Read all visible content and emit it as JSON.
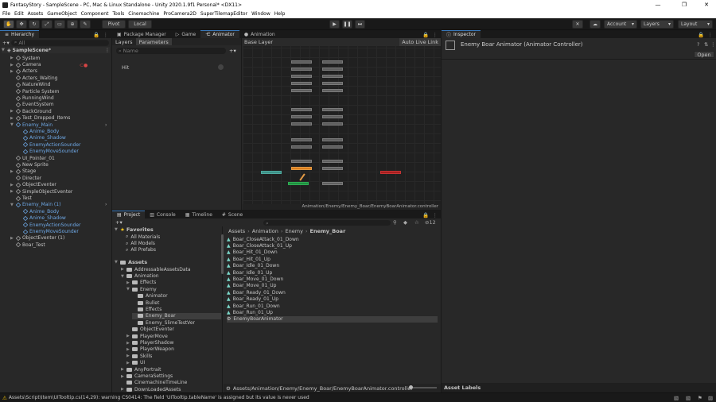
{
  "window": {
    "title": "FantasyStory - SampleScene - PC, Mac & Linux Standalone - Unity 2020.1.9f1 Personal* <DX11>",
    "minimize": "—",
    "maximize": "❐",
    "close": "✕"
  },
  "menu": [
    "File",
    "Edit",
    "Assets",
    "GameObject",
    "Component",
    "Tools",
    "Cinemachine",
    "ProCamera2D",
    "SuperTilemapEditor",
    "Window",
    "Help"
  ],
  "toolbar": {
    "pivot": "Pivot",
    "local": "Local",
    "account": "Account",
    "layers": "Layers",
    "layout": "Layout"
  },
  "hierarchy": {
    "tab": "Hierarchy",
    "search_placeholder": "All",
    "scene": "SampleScene*",
    "items": [
      {
        "label": "System",
        "indent": 1,
        "arrow": "▶",
        "blue": false
      },
      {
        "label": "Camera",
        "indent": 1,
        "arrow": "▶",
        "blue": false
      },
      {
        "label": "Acters",
        "indent": 1,
        "arrow": "▶",
        "blue": false
      },
      {
        "label": "Acters_Waiting",
        "indent": 1,
        "arrow": "",
        "blue": false
      },
      {
        "label": "NatureWind",
        "indent": 1,
        "arrow": "",
        "blue": false
      },
      {
        "label": "Particle System",
        "indent": 1,
        "arrow": "",
        "blue": false
      },
      {
        "label": "RunningWind",
        "indent": 1,
        "arrow": "",
        "blue": false
      },
      {
        "label": "EventSystem",
        "indent": 1,
        "arrow": "",
        "blue": false
      },
      {
        "label": "BackGround",
        "indent": 1,
        "arrow": "▶",
        "blue": false
      },
      {
        "label": "Test_Dropped_Items",
        "indent": 1,
        "arrow": "▶",
        "blue": false
      },
      {
        "label": "Enemy_Main",
        "indent": 1,
        "arrow": "▼",
        "blue": true
      },
      {
        "label": "Anime_Body",
        "indent": 2,
        "arrow": "",
        "blue": true
      },
      {
        "label": "Anime_Shadow",
        "indent": 2,
        "arrow": "",
        "blue": true
      },
      {
        "label": "EnemyActionSounder",
        "indent": 2,
        "arrow": "",
        "blue": true
      },
      {
        "label": "EnemyMoveSounder",
        "indent": 2,
        "arrow": "",
        "blue": true
      },
      {
        "label": "UI_Pointer_01",
        "indent": 1,
        "arrow": "",
        "blue": false
      },
      {
        "label": "New Sprite",
        "indent": 1,
        "arrow": "",
        "blue": false
      },
      {
        "label": "Stage",
        "indent": 1,
        "arrow": "▶",
        "blue": false
      },
      {
        "label": "Directer",
        "indent": 1,
        "arrow": "",
        "blue": false
      },
      {
        "label": "ObjectEventer",
        "indent": 1,
        "arrow": "▶",
        "blue": false
      },
      {
        "label": "SimpleObjectEventer",
        "indent": 1,
        "arrow": "▶",
        "blue": false
      },
      {
        "label": "Test",
        "indent": 1,
        "arrow": "",
        "blue": false
      },
      {
        "label": "Enemy_Main (1)",
        "indent": 1,
        "arrow": "▼",
        "blue": true
      },
      {
        "label": "Anime_Body",
        "indent": 2,
        "arrow": "",
        "blue": true
      },
      {
        "label": "Anime_Shadow",
        "indent": 2,
        "arrow": "",
        "blue": true
      },
      {
        "label": "EnemyActionSounder",
        "indent": 2,
        "arrow": "",
        "blue": true
      },
      {
        "label": "EnemyMoveSounder",
        "indent": 2,
        "arrow": "",
        "blue": true
      },
      {
        "label": "ObjectEventer (1)",
        "indent": 1,
        "arrow": "▶",
        "blue": false
      },
      {
        "label": "Boar_Test",
        "indent": 1,
        "arrow": "",
        "blue": false
      }
    ]
  },
  "animator": {
    "tabs": [
      "Package Manager",
      "Game",
      "Animator",
      "Animation"
    ],
    "subtabs": [
      "Layers",
      "Parameters"
    ],
    "search_placeholder": "Name",
    "param": "Hit",
    "base_layer": "Base Layer",
    "auto_live_link": "Auto Live Link",
    "path": "Animation/Enemy/Enemy_Boar/EnemyBoarAnimator.controller"
  },
  "inspector": {
    "tab": "Inspector",
    "title": "Enemy Boar Animator (Animator Controller)",
    "open": "Open",
    "asset_labels": "Asset Labels"
  },
  "project": {
    "tabs": [
      "Project",
      "Console",
      "Timeline",
      "Scene"
    ],
    "favorites": "Favorites",
    "fav_items": [
      "All Materials",
      "All Models",
      "All Prefabs"
    ],
    "assets": "Assets",
    "folders": [
      {
        "label": "AddressableAssetsData",
        "indent": 1,
        "arrow": "▶"
      },
      {
        "label": "Animation",
        "indent": 1,
        "arrow": "▼"
      },
      {
        "label": "Effects",
        "indent": 2,
        "arrow": "▶"
      },
      {
        "label": "Enemy",
        "indent": 2,
        "arrow": "▼"
      },
      {
        "label": "Animator",
        "indent": 3,
        "arrow": ""
      },
      {
        "label": "Bullet",
        "indent": 3,
        "arrow": ""
      },
      {
        "label": "Effects",
        "indent": 3,
        "arrow": ""
      },
      {
        "label": "Enemy_Boar",
        "indent": 3,
        "arrow": ""
      },
      {
        "label": "Enemy_SlimeTestVer",
        "indent": 3,
        "arrow": ""
      },
      {
        "label": "ObjectEventer",
        "indent": 2,
        "arrow": ""
      },
      {
        "label": "PlayerMove",
        "indent": 2,
        "arrow": "▶"
      },
      {
        "label": "PlayerShadow",
        "indent": 2,
        "arrow": "▶"
      },
      {
        "label": "PlayerWeapon",
        "indent": 2,
        "arrow": "▶"
      },
      {
        "label": "Skills",
        "indent": 2,
        "arrow": "▶"
      },
      {
        "label": "UI",
        "indent": 2,
        "arrow": "▶"
      },
      {
        "label": "AnyPortrait",
        "indent": 1,
        "arrow": "▶"
      },
      {
        "label": "CameraSettings",
        "indent": 1,
        "arrow": "▶"
      },
      {
        "label": "CinemachineTimeLine",
        "indent": 1,
        "arrow": ""
      },
      {
        "label": "DownLoadedAssets",
        "indent": 1,
        "arrow": "▶"
      }
    ],
    "breadcrumb": [
      "Assets",
      "Animation",
      "Enemy",
      "Enemy_Boar"
    ],
    "hidden_count": "12",
    "files": [
      "Boar_CloseAttack_01_Down",
      "Boar_CloseAttack_01_Up",
      "Boar_Hit_01_Down",
      "Boar_Hit_01_Up",
      "Boar_Idle_01_Down",
      "Boar_Idle_01_Up",
      "Boar_Move_01_Down",
      "Boar_Move_01_Up",
      "Boar_Ready_01_Down",
      "Boar_Ready_01_Up",
      "Boar_Run_01_Down",
      "Boar_Run_01_Up",
      "EnemyBoarAnimator"
    ],
    "footer_path": "Assets/Animation/Enemy/Enemy_Boar/EnemyBoarAnimator.controller"
  },
  "status": {
    "message": "Assets\\Script\\Item\\UITooltip.cs(14,29): warning CS0414: The field 'UITooltip.tableName' is assigned but its value is never used"
  },
  "colors": {
    "accent": "#3a79bb",
    "selection": "#2c5d87",
    "prefab_blue": "#6ea8e6",
    "warning": "#f5c400"
  }
}
